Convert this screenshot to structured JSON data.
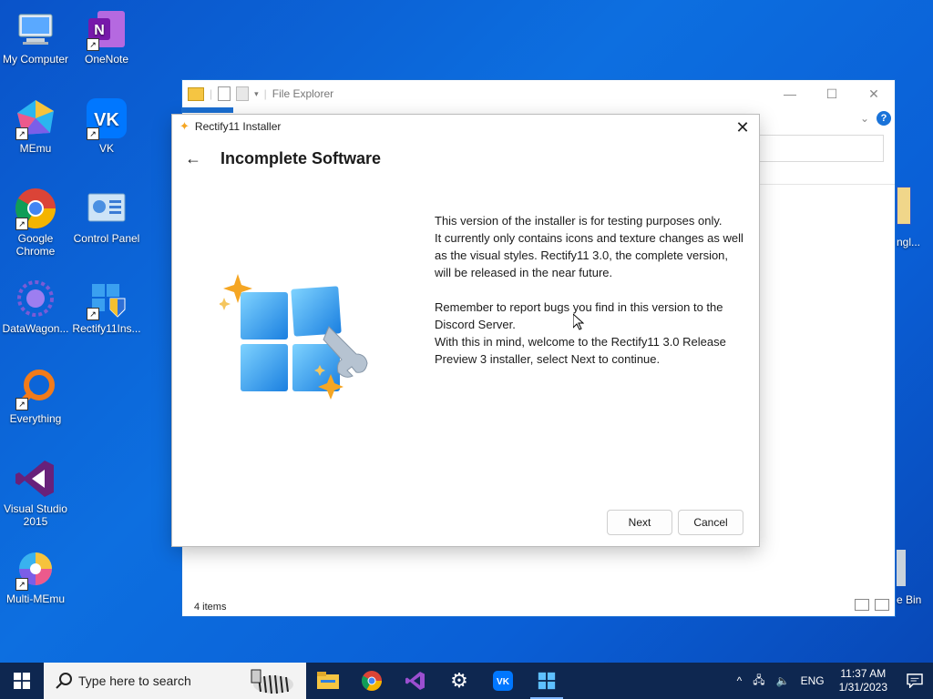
{
  "desktop": {
    "icons": [
      {
        "label": "My Computer",
        "icon": "computer-icon"
      },
      {
        "label": "OneNote",
        "icon": "onenote-icon"
      },
      {
        "label": "MEmu",
        "icon": "memu-icon"
      },
      {
        "label": "VK",
        "icon": "vk-icon"
      },
      {
        "label": "Google Chrome",
        "icon": "chrome-icon"
      },
      {
        "label": "Control Panel",
        "icon": "control-panel-icon"
      },
      {
        "label": "DataWagon...",
        "icon": "datawagon-icon"
      },
      {
        "label": "Rectify11Ins...",
        "icon": "rectify11-installer-icon"
      },
      {
        "label": "Everything",
        "icon": "everything-icon"
      },
      {
        "label": "Visual Studio 2015",
        "icon": "visual-studio-icon"
      },
      {
        "label": "Multi-MEmu",
        "icon": "multi-memu-icon"
      }
    ],
    "partial_labels": [
      "ngl...",
      "e Bin"
    ]
  },
  "explorer": {
    "title": "File Explorer",
    "status": "4 items"
  },
  "installer": {
    "window_title": "Rectify11 Installer",
    "heading": "Incomplete Software",
    "paragraph1_line1": "This version of the installer is for testing purposes only.",
    "paragraph1_line2": "It currently only contains icons and texture changes as well as the visual styles. Rectify11 3.0, the complete version, will be released in the near future.",
    "paragraph2_line1": "Remember to report bugs you find in this version to the Discord Server.",
    "paragraph2_line2": "With this in mind, welcome to the Rectify11 3.0 Release Preview 3 installer, select Next to continue.",
    "next_label": "Next",
    "cancel_label": "Cancel"
  },
  "taskbar": {
    "search_placeholder": "Type here to search",
    "pinned": [
      "file-explorer-icon",
      "chrome-icon",
      "visual-studio-icon",
      "settings-icon",
      "vk-icon",
      "rectify11-icon"
    ],
    "language": "ENG",
    "time": "11:37 AM",
    "date": "1/31/2023"
  },
  "colors": {
    "desktop_bg": "#0a53c9",
    "taskbar_bg": "#0e2750",
    "accent": "#1a73d9"
  }
}
